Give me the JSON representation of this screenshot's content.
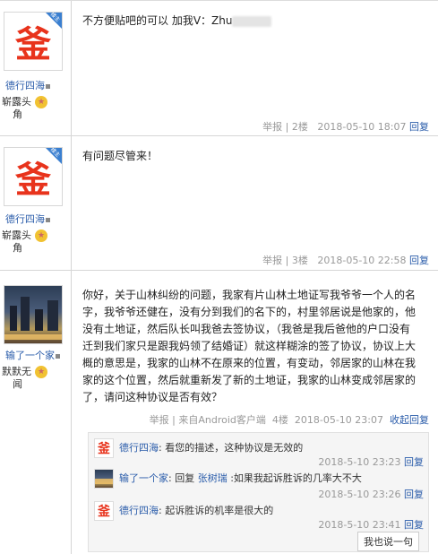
{
  "posts": [
    {
      "username": "德行四海",
      "title_line1": "崭露头",
      "title_line2": "角",
      "content": "不方便贴吧的可以 加我V：Zhu",
      "report": "举报",
      "floor": "2楼",
      "time": "2018-05-10 18:07",
      "reply": "回复",
      "badge": "楼主"
    },
    {
      "username": "德行四海",
      "title_line1": "崭露头",
      "title_line2": "角",
      "content": "有问题尽管来！",
      "report": "举报",
      "floor": "3楼",
      "time": "2018-05-10 22:58",
      "reply": "回复",
      "badge": "楼主"
    },
    {
      "username": "输了一个家",
      "title_line1": "默默无",
      "title_line2": "闻",
      "content_lines": [
        "你好，关于山林纠纷的问题，我家有片山林土地证写我爷爷一个人的名",
        "字，我爷爷还健在，没有分到我们的名下的，村里邻居说是他家的，他",
        "没有土地证，然后队长叫我爸去签协议，（我爸是我后爸他的户口没有",
        "迁到我们家只是跟我妈领了结婚证）就这样糊涂的签了协议，协议上大",
        "概的意思是，我家的山林不在原来的位置，有变动，邻居家的山林在我",
        "家的这个位置，然后就重新发了新的土地证，我家的山林变成邻居家的",
        "了，请问这种协议是否有效？"
      ],
      "report": "举报",
      "source": "来自Android客户端",
      "floor": "4楼",
      "time": "2018-05-10 23:07",
      "reply": "收起回复"
    }
  ],
  "sub_replies": [
    {
      "name": "德行四海",
      "text": "看您的描述，这种协议是无效的",
      "time": "2018-5-10 23:23",
      "reply": "回复"
    },
    {
      "name": "输了一个家",
      "text_prefix": "回复 ",
      "mention": "张树瑞",
      "text": " :如果我起诉胜诉的几率大不大",
      "time": "2018-5-10 23:26",
      "reply": "回复"
    },
    {
      "name": "德行四海",
      "text": "起诉胜诉的机率是很大的",
      "time": "2018-5-10 23:41",
      "reply": "回复"
    }
  ],
  "reply_button": "我也说一句",
  "avatar_glyph": "釜"
}
